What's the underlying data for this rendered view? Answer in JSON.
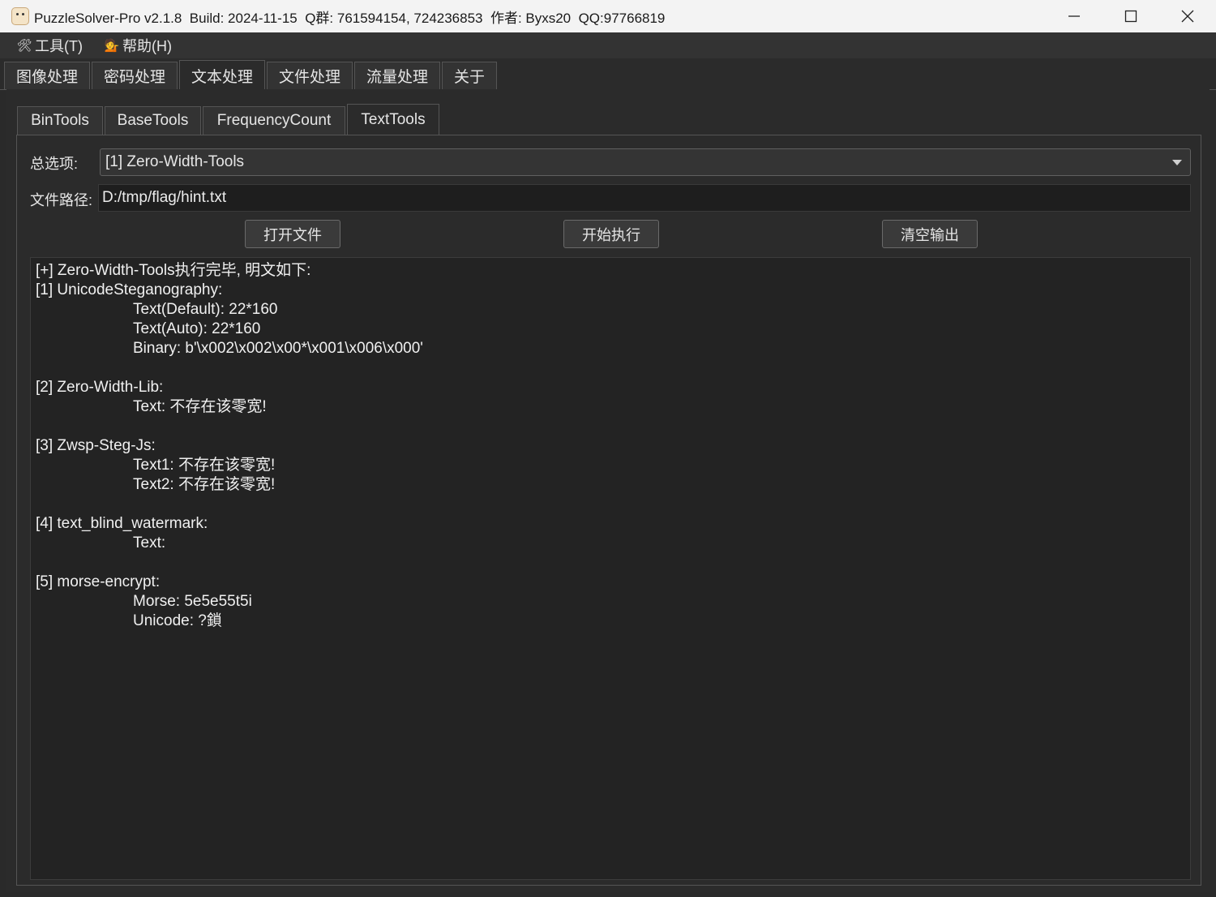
{
  "window": {
    "title": "PuzzleSolver-Pro v2.1.8  Build: 2024-11-15  Q群: 761594154, 724236853  作者: Byxs20  QQ:97766819"
  },
  "menu": [
    {
      "label": "工具(T)",
      "icon": "tools-icon"
    },
    {
      "label": "帮助(H)",
      "icon": "help-person-icon"
    }
  ],
  "top_tabs": [
    "图像处理",
    "密码处理",
    "文本处理",
    "文件处理",
    "流量处理",
    "关于"
  ],
  "top_tab_active": "文本处理",
  "sub_tabs": [
    "BinTools",
    "BaseTools",
    "FrequencyCount",
    "TextTools"
  ],
  "sub_tab_active": "TextTools",
  "form": {
    "option_label": "总选项:",
    "option_value": "[1] Zero-Width-Tools",
    "path_label": "文件路径:",
    "path_value": "D:/tmp/flag/hint.txt"
  },
  "buttons": {
    "open_file": "打开文件",
    "execute": "开始执行",
    "clear_output": "清空输出"
  },
  "output": {
    "lines": [
      {
        "text": "[+] Zero-Width-Tools执行完毕, 明文如下:",
        "indent": false
      },
      {
        "text": "[1] UnicodeSteganography:",
        "indent": false
      },
      {
        "text": "Text(Default): 22*160",
        "indent": true
      },
      {
        "text": "Text(Auto): 22*160",
        "indent": true
      },
      {
        "text": "Binary: b'\\x002\\x002\\x00*\\x001\\x006\\x000'",
        "indent": true
      },
      {
        "text": "",
        "indent": false
      },
      {
        "text": "[2] Zero-Width-Lib:",
        "indent": false
      },
      {
        "text": "Text: 不存在该零宽!",
        "indent": true
      },
      {
        "text": "",
        "indent": false
      },
      {
        "text": "[3] Zwsp-Steg-Js:",
        "indent": false
      },
      {
        "text": "Text1: 不存在该零宽!",
        "indent": true
      },
      {
        "text": "Text2: 不存在该零宽!",
        "indent": true
      },
      {
        "text": "",
        "indent": false
      },
      {
        "text": "[4] text_blind_watermark:",
        "indent": false
      },
      {
        "text": "Text:",
        "indent": true
      },
      {
        "text": "",
        "indent": false
      },
      {
        "text": "[5] morse-encrypt:",
        "indent": false
      },
      {
        "text": "Morse: 5e5e55t5i",
        "indent": true
      },
      {
        "text": "Unicode: ?鎖",
        "indent": true
      }
    ]
  }
}
